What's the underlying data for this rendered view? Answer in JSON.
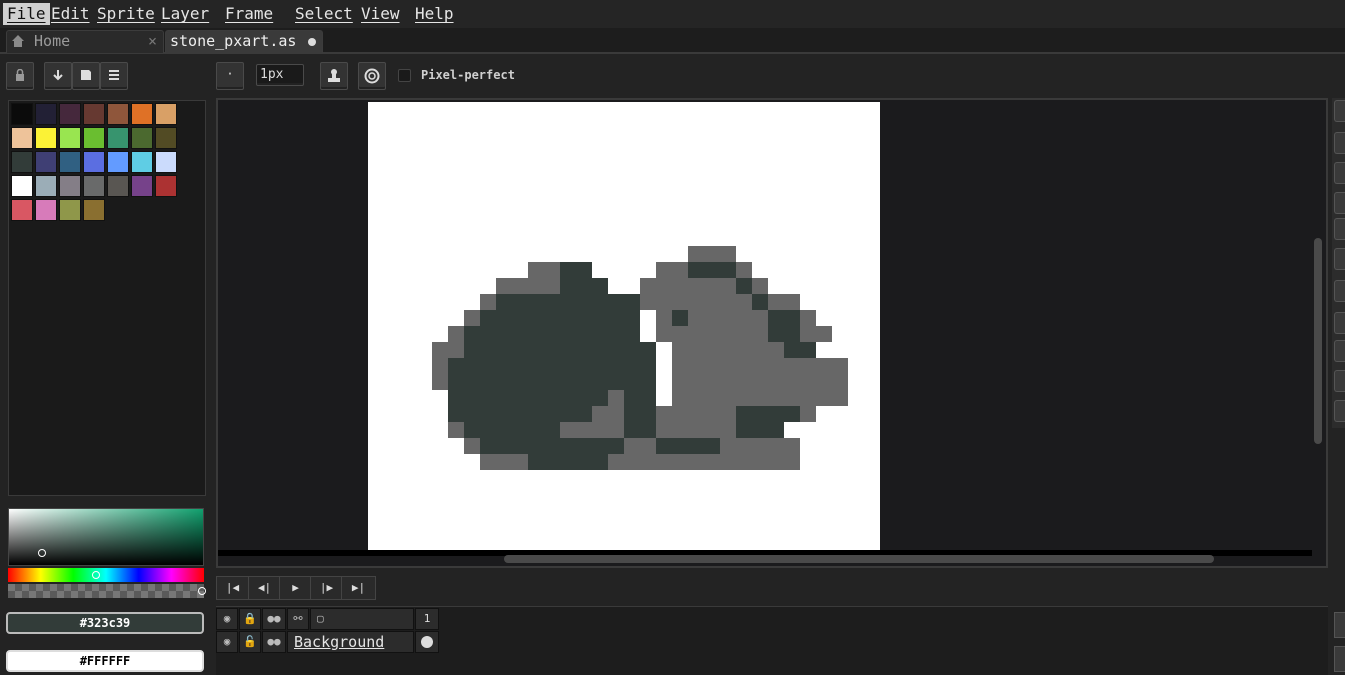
{
  "menu": {
    "items": [
      "File",
      "Edit",
      "Sprite",
      "Layer",
      "Frame",
      "Select",
      "View",
      "Help"
    ]
  },
  "tabs": {
    "home": "Home",
    "file": "stone_pxart.as"
  },
  "toolbar": {
    "brush_size": "1px",
    "pixel_perfect_label": "Pixel-perfect",
    "pixel_perfect_checked": false
  },
  "palette": {
    "colors": [
      "#0b0b0b",
      "#222035",
      "#45283c",
      "#663931",
      "#8f563b",
      "#df7126",
      "#d9a066",
      "#eec39a",
      "#fbf236",
      "#99e550",
      "#6abe30",
      "#37946e",
      "#4b692f",
      "#524b24",
      "#323c39",
      "#3f3f74",
      "#306082",
      "#5b6ee1",
      "#639bff",
      "#5fcde4",
      "#cbdbfc",
      "#ffffff",
      "#9badb7",
      "#847e87",
      "#696a6a",
      "#595652",
      "#76428a",
      "#ac3232",
      "#d95763",
      "#d77bba",
      "#8f974a",
      "#8a6f30"
    ]
  },
  "colors": {
    "foreground_hex": "#323c39",
    "background_hex": "#FFFFFF",
    "accent": "#323c39"
  },
  "layers": {
    "frame_number": "1",
    "items": [
      {
        "name": "Background"
      }
    ]
  },
  "icons": [
    "home-icon",
    "close-icon",
    "lock-icon",
    "arrow-down-icon",
    "save-icon",
    "menu-icon",
    "pencil-icon",
    "stamp-icon",
    "target-icon",
    "eye-icon",
    "link-icon",
    "first-frame-icon",
    "prev-frame-icon",
    "play-icon",
    "next-frame-icon",
    "last-frame-icon"
  ]
}
